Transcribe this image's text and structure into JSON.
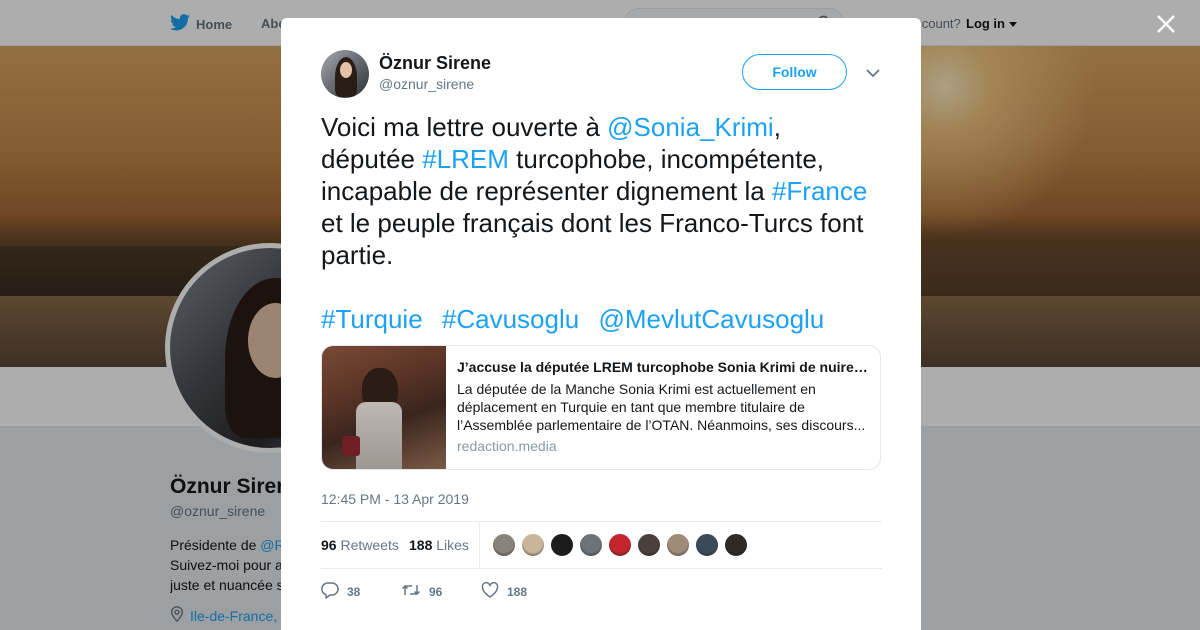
{
  "topbar": {
    "home_label": "Home",
    "about_label": "Abo",
    "account_label": "account?",
    "login_label": "Log in"
  },
  "profile_bg": {
    "name": "Öznur Sirene",
    "handle": "@oznur_sirene",
    "bio_line1_prefix": "Présidente de ",
    "bio_line1_link": "@R",
    "bio_line2": "Suivez-moi pour a",
    "bio_line3": "juste et nuancée s",
    "location": "Ile-de-France,"
  },
  "tweet": {
    "author_name": "Öznur Sirene",
    "author_handle": "@oznur_sirene",
    "follow_label": "Follow",
    "text": {
      "p1": "Voici ma lettre ouverte à ",
      "mention1": "@Sonia_Krimi",
      "p2": ", députée ",
      "hashtag1": "#LREM",
      "p3": " turcophobe, incompétente, incapable de représenter dignement la ",
      "hashtag2": "#France",
      "p4": " et le peuple français dont les Franco-Turcs font partie."
    },
    "tags": [
      "#Turquie",
      "#Cavusoglu",
      "@MevlutCavusoglu"
    ],
    "card": {
      "title": "J’accuse la députée LREM turcophobe Sonia Krimi de nuire à…",
      "description": "La députée de la Manche Sonia Krimi est actuellement en déplacement en Turquie en tant que membre titulaire de l’Assemblée parlementaire de l’OTAN. Néanmoins, ses discours...",
      "domain": "redaction.media"
    },
    "timestamp": "12:45 PM - 13 Apr 2019",
    "stats": {
      "retweets_count": "96",
      "retweets_label": "Retweets",
      "likes_count": "188",
      "likes_label": "Likes"
    },
    "liker_avatar_colors": [
      "#8a8478",
      "#c8b59a",
      "#1c1c1c",
      "#6e7378",
      "#c4242e",
      "#4a3f3b",
      "#a08b78",
      "#3a4a5a",
      "#2d2a28"
    ],
    "actions": {
      "replies": "38",
      "retweets": "96",
      "likes": "188"
    }
  },
  "colors": {
    "accent": "#1da1f2",
    "text": "#14171a",
    "muted": "#657786"
  }
}
